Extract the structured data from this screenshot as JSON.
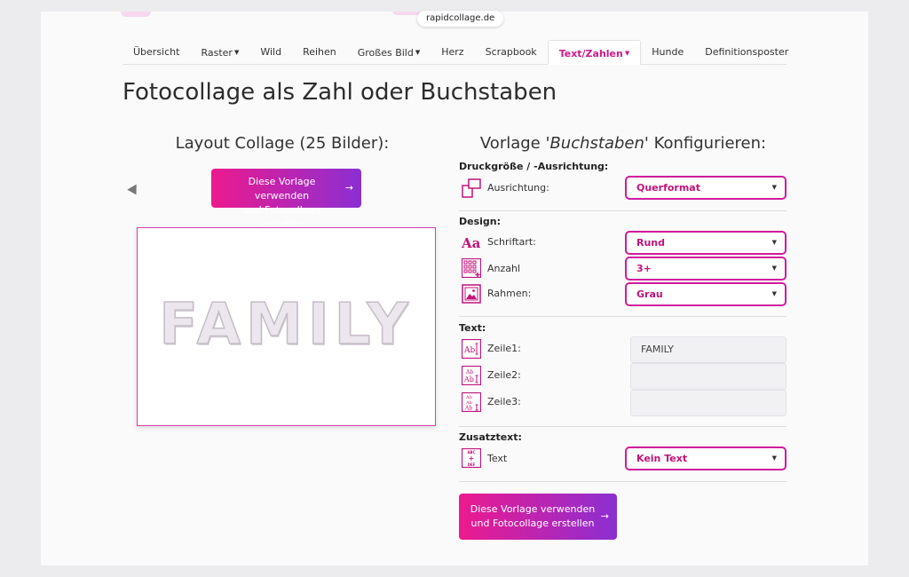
{
  "browser": {
    "url": "rapidcollage.de"
  },
  "nav": {
    "items": [
      {
        "label": "Übersicht",
        "caret": ""
      },
      {
        "label": "Raster",
        "caret": "▼"
      },
      {
        "label": "Wild",
        "caret": ""
      },
      {
        "label": "Reihen",
        "caret": ""
      },
      {
        "label": "Großes Bild",
        "caret": "▼"
      },
      {
        "label": "Herz",
        "caret": ""
      },
      {
        "label": "Scrapbook",
        "caret": ""
      },
      {
        "label": "Text/Zahlen",
        "caret": "▼"
      },
      {
        "label": "Hunde",
        "caret": ""
      },
      {
        "label": "Definitionsposter",
        "caret": ""
      }
    ],
    "active_index": 7
  },
  "page": {
    "title": "Fotocollage als Zahl oder Buchstaben"
  },
  "left": {
    "title": "Layout Collage (25 Bilder):",
    "button_line1": "Diese Vorlage verwenden",
    "button_line2": "und Fotocollage erstellen",
    "button_arrow": "→",
    "preview_text": "FAMILY"
  },
  "right": {
    "title_prefix": "Vorlage",
    "title_italic": "'Buchstaben'",
    "title_suffix": "Konfigurieren:",
    "sections": {
      "print": "Druckgröße / -Ausrichtung:",
      "design": "Design:",
      "text": "Text:",
      "extra": "Zusatztext:"
    },
    "rows": {
      "ausrichtung": {
        "label": "Ausrichtung:",
        "value": "Querformat"
      },
      "schriftart": {
        "label": "Schriftart:",
        "value": "Rund"
      },
      "anzahl": {
        "label": "Anzahl",
        "value": "3+"
      },
      "rahmen": {
        "label": "Rahmen:",
        "value": "Grau"
      },
      "zeile1": {
        "label": "Zeile1:",
        "value": "FAMILY"
      },
      "zeile2": {
        "label": "Zeile2:",
        "value": ""
      },
      "zeile3": {
        "label": "Zeile3:",
        "value": ""
      },
      "zusatz": {
        "label": "Text",
        "value": "Kein Text"
      }
    },
    "dropdown_arrow": "▼",
    "button_line1": "Diese Vorlage verwenden",
    "button_line2": "und Fotocollage erstellen",
    "button_arrow": "→"
  },
  "icons": {
    "font": "Aa",
    "line1": [
      "Ab"
    ],
    "line2": [
      "Ab",
      "Ab"
    ],
    "line3": [
      "Ab",
      "Ab",
      "Ab"
    ],
    "extra_top": "ABC",
    "extra_bottom": "DEF",
    "extra_mid": "+"
  },
  "colors": {
    "accent": "#d01b9c",
    "gradient_start": "#ec1a8e",
    "gradient_end": "#8b2fd2"
  }
}
